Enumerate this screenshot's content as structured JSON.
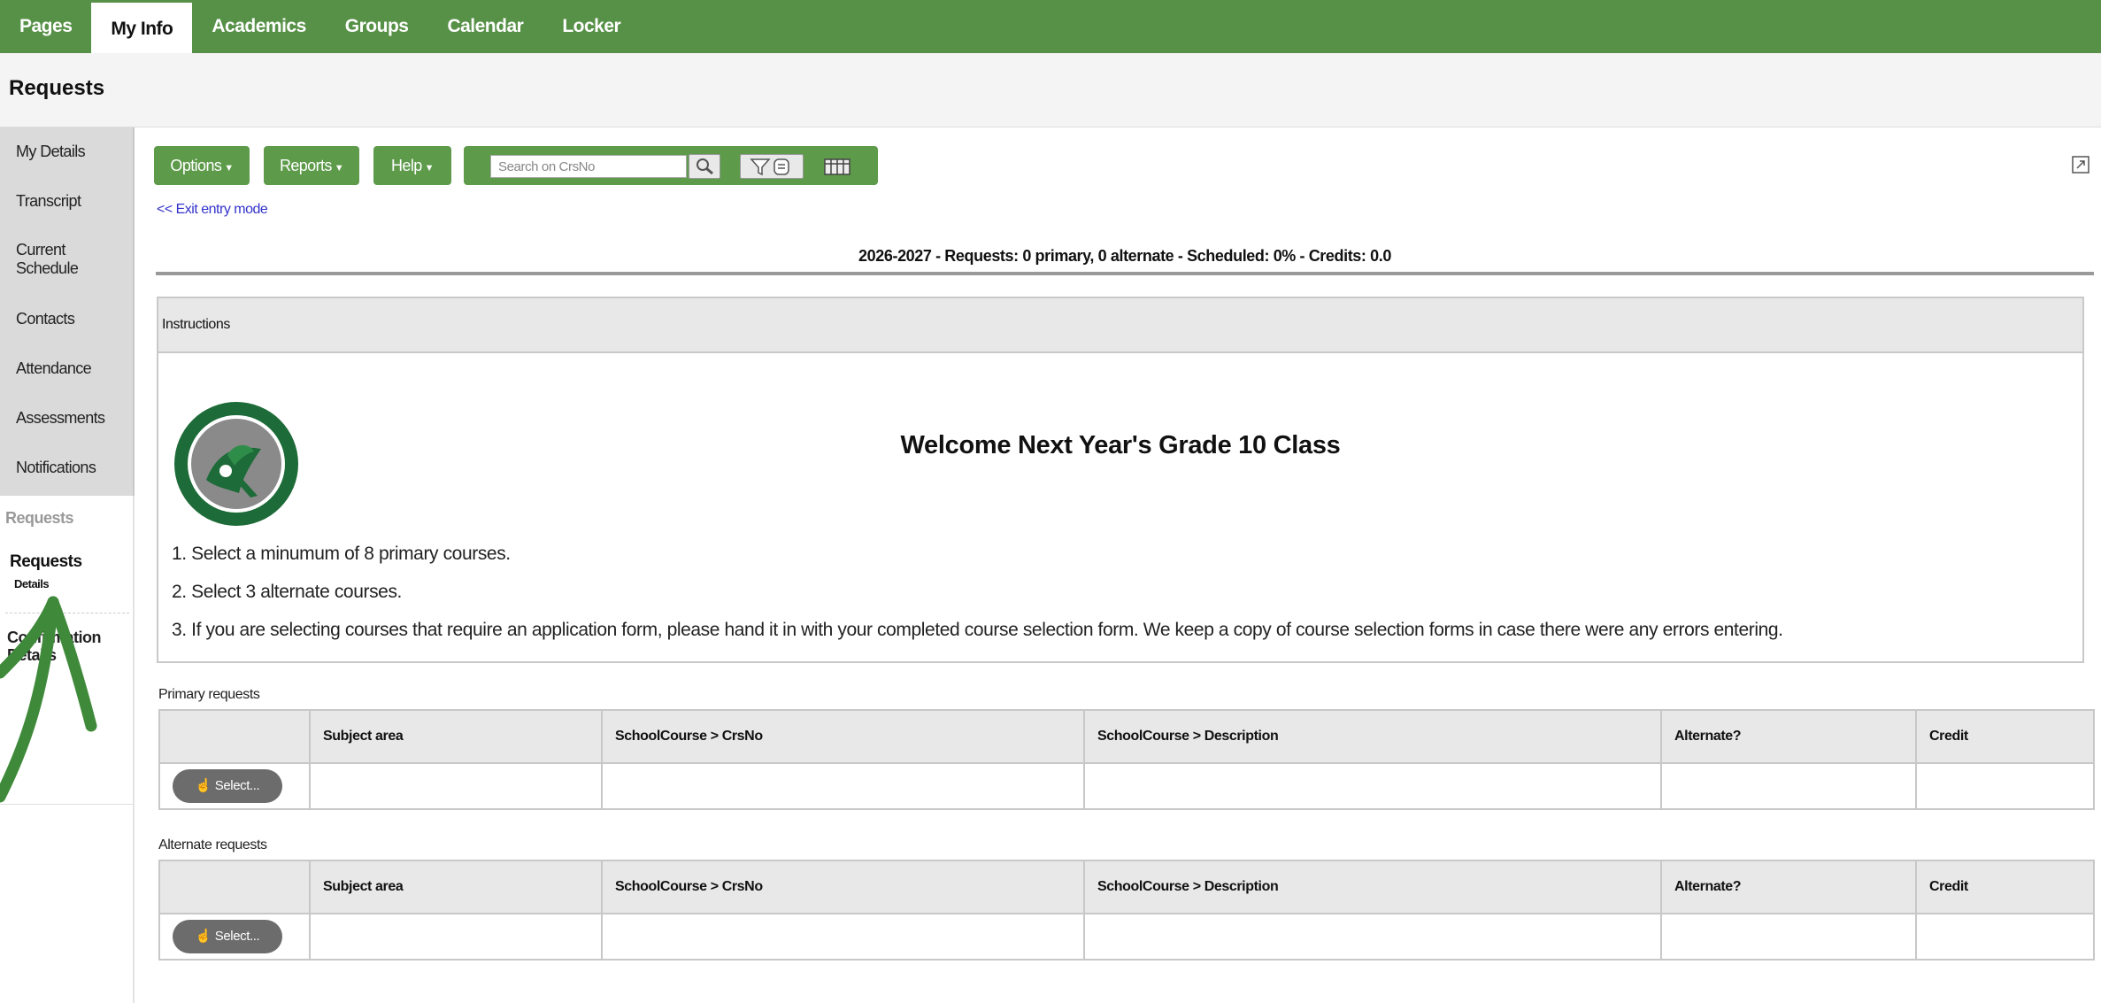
{
  "nav": {
    "tabs": [
      {
        "label": "Pages",
        "active": false
      },
      {
        "label": "My Info",
        "active": true
      },
      {
        "label": "Academics",
        "active": false
      },
      {
        "label": "Groups",
        "active": false
      },
      {
        "label": "Calendar",
        "active": false
      },
      {
        "label": "Locker",
        "active": false
      }
    ]
  },
  "page": {
    "title": "Requests"
  },
  "sidebar": {
    "items": [
      "My Details",
      "Transcript",
      "Current Schedule",
      "Contacts",
      "Attendance",
      "Assessments",
      "Notifications"
    ],
    "section_label": "Requests",
    "requests_label": "Requests",
    "details_label": "Details",
    "confirmation_label": "Confirmation Details"
  },
  "toolbar": {
    "options_label": "Options",
    "reports_label": "Reports",
    "help_label": "Help",
    "search_placeholder": "Search on CrsNo"
  },
  "exit_link": "<< Exit entry mode",
  "summary": "2026-2027 - Requests: 0 primary, 0 alternate - Scheduled: 0% - Credits: 0.0",
  "instructions": {
    "header": "Instructions",
    "welcome": "Welcome Next Year's Grade 10 Class",
    "steps": [
      "1. Select a minumum of 8 primary courses.",
      "2.  Select 3 alternate courses.",
      "3.  If you are selecting courses that require an application form, please hand it in with your completed course selection form. We keep a copy of course selection forms in case there were any errors entering."
    ]
  },
  "primary": {
    "label": "Primary requests",
    "columns": [
      "",
      "Subject area",
      "SchoolCourse > CrsNo",
      "SchoolCourse > Description",
      "Alternate?",
      "Credit"
    ],
    "select_label": "Select..."
  },
  "alternate": {
    "label": "Alternate requests",
    "columns": [
      "",
      "Subject area",
      "SchoolCourse > CrsNo",
      "SchoolCourse > Description",
      "Alternate?",
      "Credit"
    ],
    "select_label": "Select..."
  },
  "colors": {
    "brand_green": "#579147",
    "link_blue": "#3333cc",
    "annotation_arrow": "#3f8a3a"
  }
}
